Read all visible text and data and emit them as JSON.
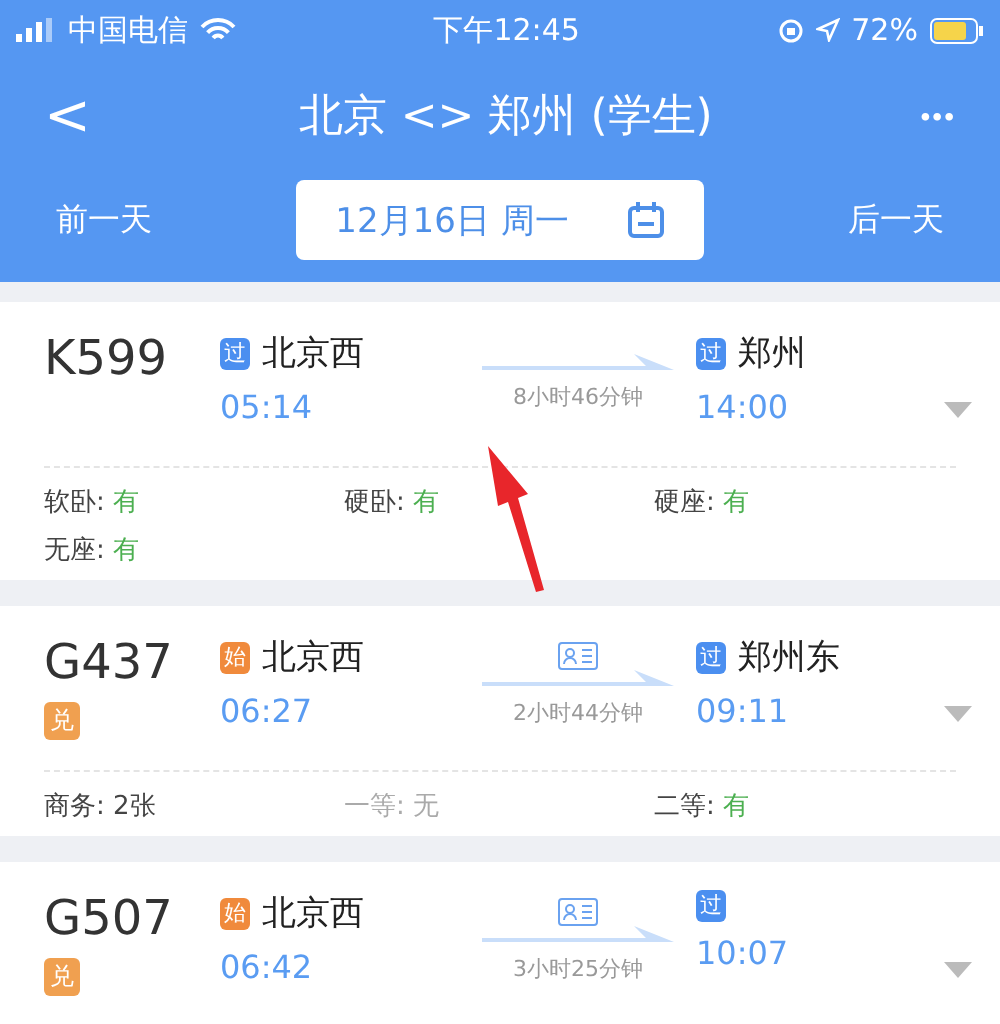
{
  "status_bar": {
    "carrier": "中国电信",
    "time": "下午12:45",
    "battery": "72%"
  },
  "nav": {
    "back": "<",
    "title": "北京 <> 郑州 (学生)",
    "more": "•••"
  },
  "date_bar": {
    "prev": "前一天",
    "date": "12月16日 周一",
    "next": "后一天"
  },
  "trains": [
    {
      "number": "K599",
      "from": {
        "badge": "过",
        "kind": "pass",
        "name": "北京西",
        "time": "05:14"
      },
      "to": {
        "badge": "过",
        "kind": "pass",
        "name": "郑州",
        "time": "14:00"
      },
      "duration": "8小时46分钟",
      "id_card": false,
      "annotated": true,
      "seats": [
        {
          "label": "软卧:",
          "value": "有",
          "kind": "available"
        },
        {
          "label": "硬卧:",
          "value": "有",
          "kind": "available"
        },
        {
          "label": "硬座:",
          "value": "有",
          "kind": "available"
        },
        {
          "label": "无座:",
          "value": "有",
          "kind": "available"
        }
      ]
    },
    {
      "number": "G437",
      "tag": "兑",
      "from": {
        "badge": "始",
        "kind": "start",
        "name": "北京西",
        "time": "06:27"
      },
      "to": {
        "badge": "过",
        "kind": "pass",
        "name": "郑州东",
        "time": "09:11"
      },
      "duration": "2小时44分钟",
      "id_card": true,
      "annotated": false,
      "seats": [
        {
          "label": "商务:",
          "value": "2张",
          "kind": "count"
        },
        {
          "label": "一等:",
          "value": "无",
          "kind": "unavailable"
        },
        {
          "label": "二等:",
          "value": "有",
          "kind": "available"
        }
      ]
    },
    {
      "number": "G507",
      "tag": "兑",
      "from": {
        "badge": "始",
        "kind": "start",
        "name": "北京西",
        "time": "06:42"
      },
      "to": {
        "badge": "过",
        "kind": "pass",
        "time": "10:07"
      },
      "duration": "3小时25分钟",
      "id_card": true,
      "annotated": false
    }
  ]
}
